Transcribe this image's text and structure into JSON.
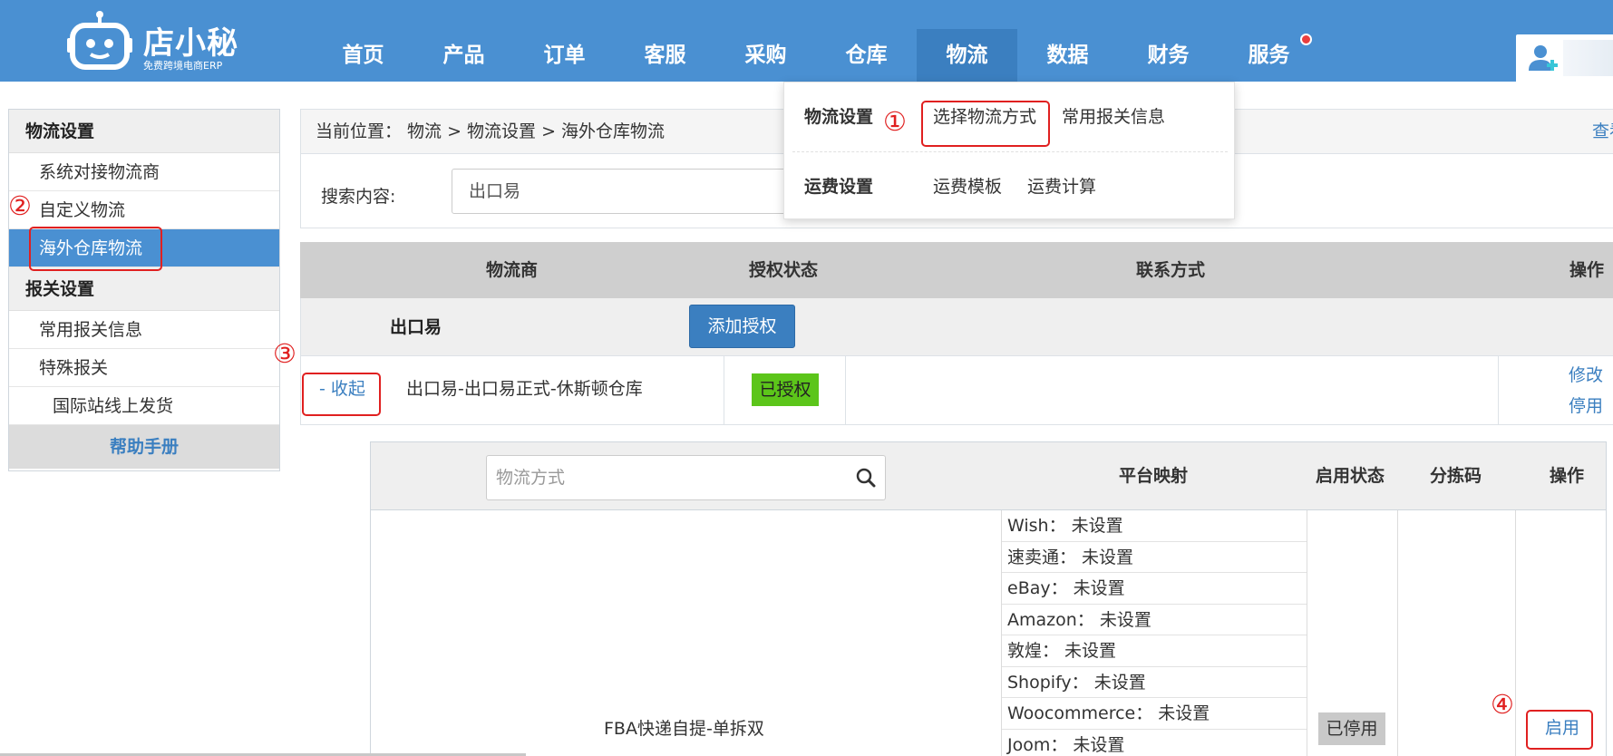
{
  "brand": {
    "name": "店小秘",
    "tagline": "免费跨境电商ERP"
  },
  "nav": {
    "items": [
      "首页",
      "产品",
      "订单",
      "客服",
      "采购",
      "仓库",
      "物流",
      "数据",
      "财务",
      "服务"
    ],
    "active": "物流"
  },
  "dropdown": {
    "logistics_settings_title": "物流设置",
    "select_method": "选择物流方式",
    "customs_info": "常用报关信息",
    "freight_settings_title": "运费设置",
    "freight_template": "运费模板",
    "freight_calc": "运费计算"
  },
  "annotations": {
    "step1": "①",
    "step2": "②",
    "step3": "③",
    "step4": "④"
  },
  "sidebar": {
    "section1_title": "物流设置",
    "item_system": "系统对接物流商",
    "item_custom": "自定义物流",
    "item_overseas": "海外仓库物流",
    "section2_title": "报关设置",
    "item_customs_info": "常用报关信息",
    "item_special": "特殊报关",
    "item_intl": "国际站线上发货",
    "help": "帮助手册"
  },
  "breadcrumb": {
    "text": "当前位置： 物流 > 物流设置 > 海外仓库物流",
    "more": "查看"
  },
  "search": {
    "label": "搜索内容:",
    "value": "出口易"
  },
  "main_table": {
    "headers": {
      "provider": "物流商",
      "auth_status": "授权状态",
      "contact": "联系方式",
      "action": "操作"
    },
    "group": {
      "name": "出口易",
      "add_auth_button": "添加授权"
    },
    "row": {
      "collapse": "- 收起",
      "warehouse": "出口易-出口易正式-休斯顿仓库",
      "status": "已授权",
      "edit": "修改",
      "disable": "停用"
    }
  },
  "sub_table": {
    "search_placeholder": "物流方式",
    "headers": {
      "platform_mapping": "平台映射",
      "enabled_status": "启用状态",
      "sort_code": "分拣码",
      "action": "操作"
    },
    "method_name": "FBA快递自提-单拆双",
    "mappings": [
      "Wish：  未设置",
      "速卖通：  未设置",
      "eBay：  未设置",
      "Amazon：  未设置",
      "敦煌：  未设置",
      "Shopify：  未设置",
      "Woocommerce：  未设置",
      "Joom：  未设置"
    ],
    "status": "已停用",
    "enable": "启用"
  },
  "colors": {
    "brand_blue": "#4a90d2",
    "highlight_red": "#e02020",
    "authorized_green": "#5cc51a"
  }
}
